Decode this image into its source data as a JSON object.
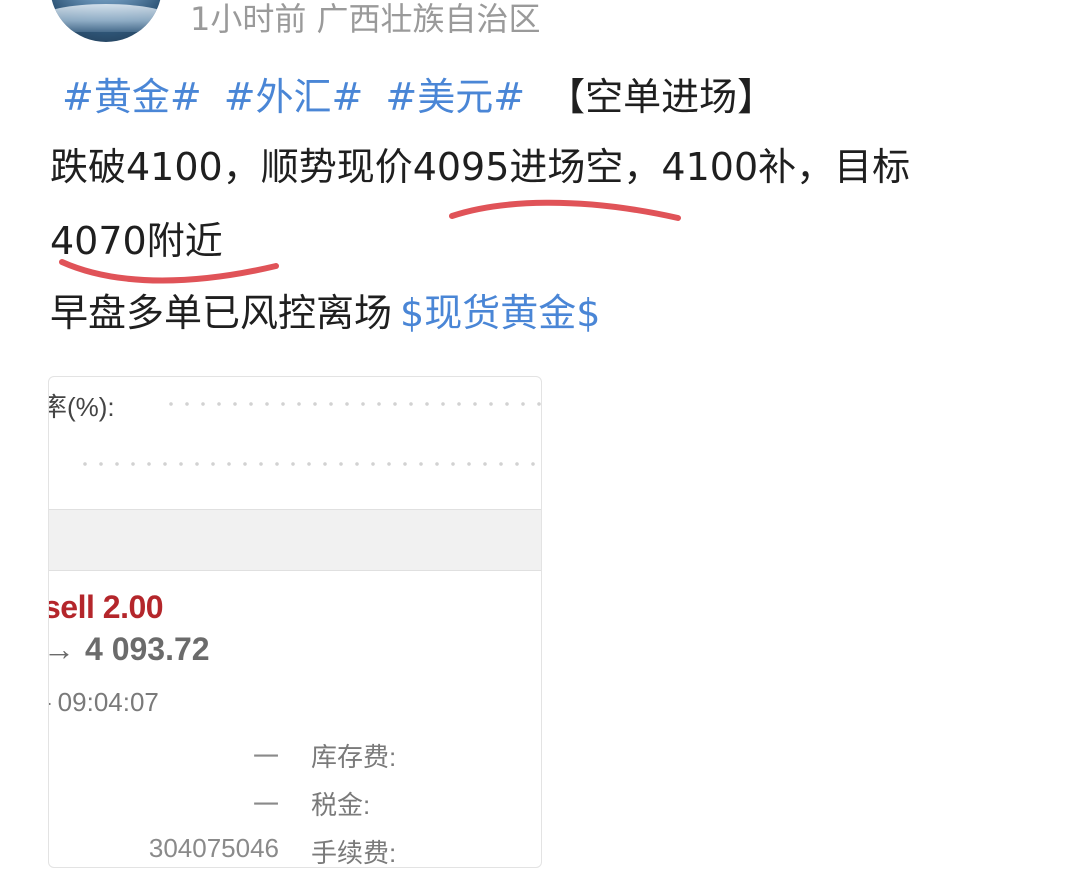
{
  "header": {
    "meta_text": "1小时前 广西壮族自治区"
  },
  "post": {
    "tags": [
      "#黄金#",
      "#外汇#",
      "#美元#"
    ],
    "bracket_title": "【空单进场】",
    "line2": "跌破4100，顺势现价4095进场空，4100补，目标",
    "line3": "4070附近",
    "line4_text": "早盘多单已风控离场",
    "line4_link": "$现货黄金$"
  },
  "card": {
    "rate_label": "率(%):",
    "order_type": "sell 2.00",
    "price_arrow": "→",
    "price": "4 093.72",
    "time_dash": "-",
    "time": "09:04:07",
    "rows": [
      {
        "value": "一",
        "key": "库存费:"
      },
      {
        "value": "一",
        "key": "税金:"
      },
      {
        "value": "304075046",
        "key": "手续费:"
      }
    ]
  },
  "colors": {
    "link": "#4a86d6",
    "underline": "#e05358",
    "sell": "#b4262b",
    "meta": "#9a9a9a"
  },
  "icons": [
    "avatar-image",
    "right-arrow-icon"
  ]
}
